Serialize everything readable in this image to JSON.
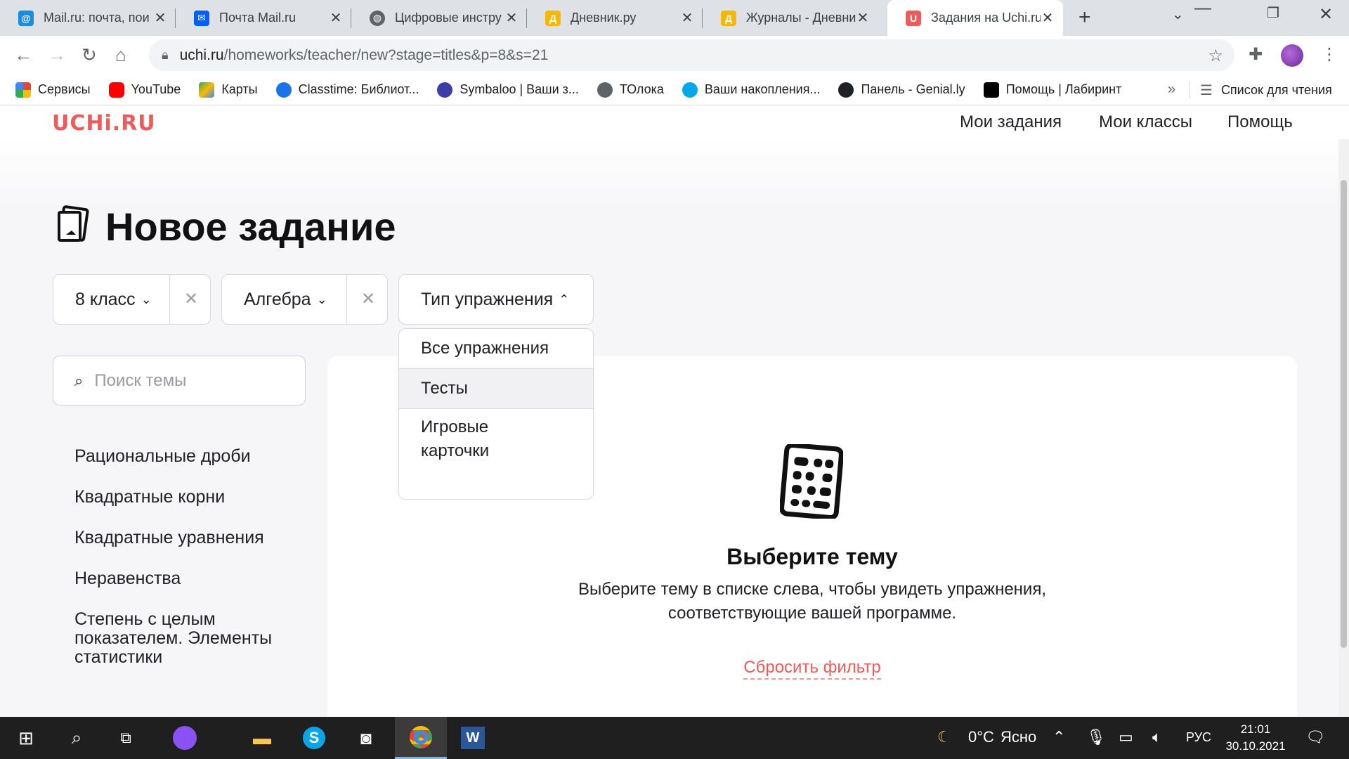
{
  "tabs": [
    {
      "title": "Mail.ru: почта, пои",
      "icon": "mailru-at-icon",
      "color": "#168de2",
      "glyph": "@"
    },
    {
      "title": "Почта Mail.ru",
      "icon": "mail-envelope-icon",
      "color": "#005ff9",
      "glyph": "✉"
    },
    {
      "title": "Цифровые инстру",
      "icon": "globe-icon",
      "color": "#5f6368",
      "glyph": "◍"
    },
    {
      "title": "Дневник.ру",
      "icon": "dnevnik-icon",
      "color": "#f5b700",
      "glyph": "Д"
    },
    {
      "title": "Журналы - Дневни",
      "icon": "dnevnik-icon",
      "color": "#f5b700",
      "glyph": "Д"
    },
    {
      "title": "Задания на Uchi.ru",
      "icon": "uchi-icon",
      "color": "#ee5b5b",
      "glyph": "U",
      "active": true
    }
  ],
  "toolbar": {
    "url_host": "uchi.ru",
    "url_path": "/homeworks/teacher/new?stage=titles&p=8&s=21"
  },
  "bookmarks": [
    {
      "label": "Сервисы",
      "icon": "apps-grid-icon",
      "color": "#ea4335"
    },
    {
      "label": "YouTube",
      "icon": "youtube-icon",
      "color": "#ff0000"
    },
    {
      "label": "Карты",
      "icon": "maps-icon",
      "color": "#34a853"
    },
    {
      "label": "Classtime: Библиот...",
      "icon": "classtime-icon",
      "color": "#1a73e8"
    },
    {
      "label": "Symbaloo | Ваши з...",
      "icon": "symbaloo-icon",
      "color": "#3b3fa5"
    },
    {
      "label": "ТОлока",
      "icon": "globe-icon",
      "color": "#5f6368"
    },
    {
      "label": "Ваши накопления...",
      "icon": "savings-icon",
      "color": "#00a8e8"
    },
    {
      "label": "Панель - Genial.ly",
      "icon": "genially-icon",
      "color": "#202124"
    },
    {
      "label": "Помощь | Лабиринт",
      "icon": "labirint-icon",
      "color": "#000000"
    }
  ],
  "reading_list": "Список для чтения",
  "site": {
    "logo": "UCHi.RU",
    "nav": [
      "Мои задания",
      "Мои классы",
      "Помощь"
    ]
  },
  "page": {
    "title": "Новое задание",
    "filters": {
      "grade": "8 класс",
      "subject": "Алгебра",
      "exercise_type": "Тип упражнения"
    },
    "search_placeholder": "Поиск темы",
    "topics": [
      "Рациональные дроби",
      "Квадратные корни",
      "Квадратные уравнения",
      "Неравенства",
      "Степень с целым показателем. Элементы статистики"
    ],
    "dropdown": [
      "Все упражнения",
      "Тесты",
      "Игровые карточки"
    ],
    "empty_title": "Выберите тему",
    "empty_text": "Выберите тему в списке слева, чтобы увидеть упражнения, соответствующие вашей программе.",
    "reset": "Сбросить фильтр"
  },
  "taskbar": {
    "weather_temp": "0°C",
    "weather_text": "Ясно",
    "lang": "РУС",
    "time": "21:01",
    "date": "30.10.2021"
  },
  "colors": {
    "brand": "#ee5b5b",
    "page_bg": "#f6f6f8",
    "tab_strip": "#dee1e6"
  }
}
